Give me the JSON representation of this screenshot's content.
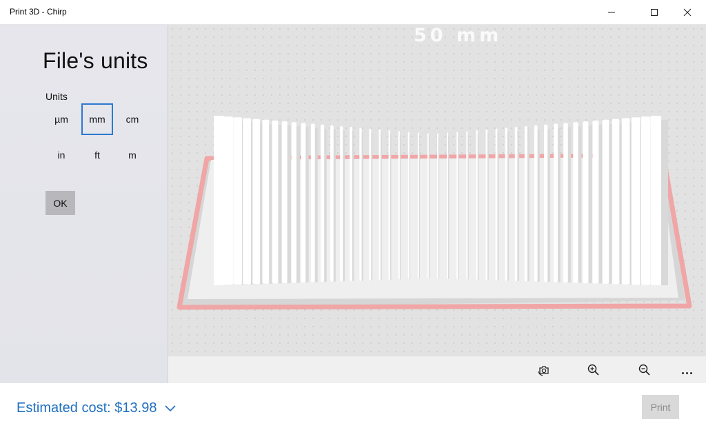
{
  "window": {
    "title": "Print 3D - Chirp",
    "minimize_icon": "minimize-icon",
    "maximize_icon": "maximize-icon",
    "close_icon": "close-icon"
  },
  "units_panel": {
    "heading": "File's units",
    "units_label": "Units",
    "options": [
      "µm",
      "mm",
      "cm",
      "in",
      "ft",
      "m"
    ],
    "selected": "mm",
    "ok_label": "OK"
  },
  "viewport": {
    "scale_label": "50 mm",
    "bed_outline_color": "#f2a1a1",
    "model_color": "#ffffff"
  },
  "viewport_toolbar": {
    "icons": [
      "reset-view-icon",
      "zoom-in-icon",
      "zoom-out-icon",
      "more-icon"
    ],
    "more_label": "..."
  },
  "footer": {
    "cost_label": "Estimated cost: $13.98",
    "print_label": "Print",
    "accent": "#1f6fc0"
  }
}
